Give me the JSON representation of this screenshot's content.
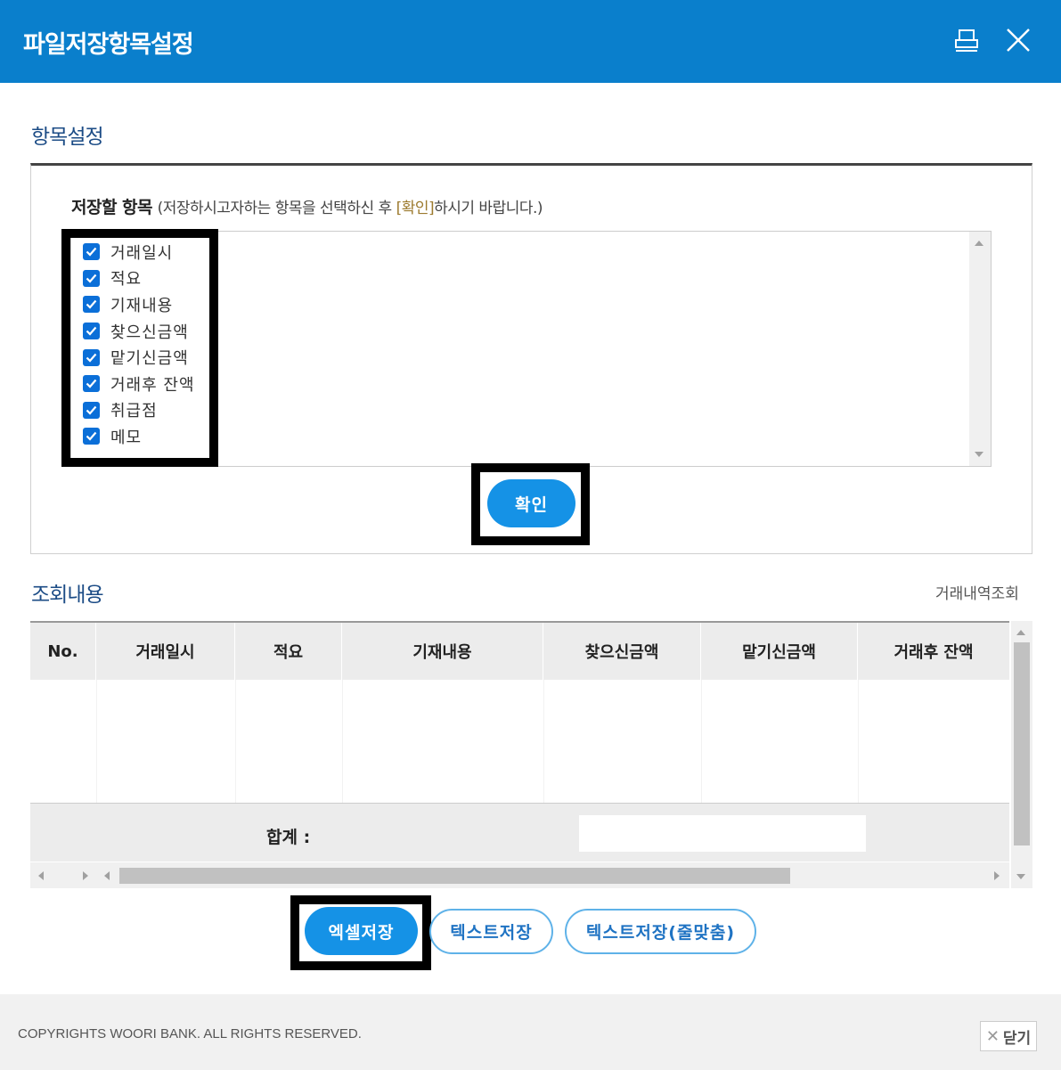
{
  "window": {
    "title": "파일저장항목설정",
    "icons": [
      "print-icon",
      "close-icon"
    ]
  },
  "item_settings": {
    "section_title": "항목설정",
    "save_label_bold": "저장할 항목",
    "hint_open": "(저장하시고자하는 항목을 선택하신 후 ",
    "hint_highlight": "[확인]",
    "hint_close": "하시기 바랍니다.)",
    "items": [
      {
        "label": "거래일시",
        "checked": true
      },
      {
        "label": "적요",
        "checked": true
      },
      {
        "label": "기재내용",
        "checked": true
      },
      {
        "label": "찾으신금액",
        "checked": true
      },
      {
        "label": "맡기신금액",
        "checked": true
      },
      {
        "label": "거래후 잔액",
        "checked": true
      },
      {
        "label": "취급점",
        "checked": true
      },
      {
        "label": "메모",
        "checked": true
      }
    ],
    "confirm_button": "확인"
  },
  "query": {
    "section_title": "조회내용",
    "link": "거래내역조회",
    "columns": [
      "No.",
      "거래일시",
      "적요",
      "기재내용",
      "찾으신금액",
      "맡기신금액",
      "거래후 잔액"
    ],
    "total_label": "합계 :"
  },
  "buttons": {
    "excel": "엑셀저장",
    "text": "텍스트저장",
    "text_line": "텍스트저장(줄맞춤)"
  },
  "footer": {
    "copyright": "COPYRIGHTS WOORI BANK. ALL RIGHTS RESERVED.",
    "close": "닫기"
  },
  "colors": {
    "header_bg": "#0a7fcc",
    "primary": "#1592e6",
    "checkbox": "#0b6fd8",
    "section_title": "#1c4c86"
  }
}
